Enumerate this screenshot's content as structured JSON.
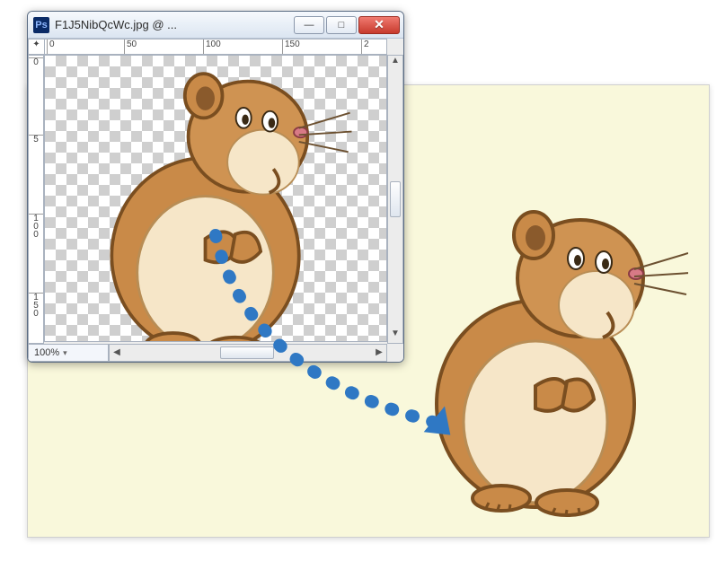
{
  "window": {
    "app_icon_text": "Ps",
    "title": "F1J5NibQcWc.jpg @ ...",
    "buttons": {
      "min": "—",
      "max": "□",
      "close": "✕"
    },
    "zoom": "100%",
    "ruler_h": [
      "0",
      "50",
      "100",
      "150",
      "2"
    ],
    "ruler_v": [
      "0",
      "5",
      "1\n0\n0",
      "1\n5\n0"
    ],
    "corner": "✦"
  },
  "drag": {
    "color": "#2f78c4"
  }
}
